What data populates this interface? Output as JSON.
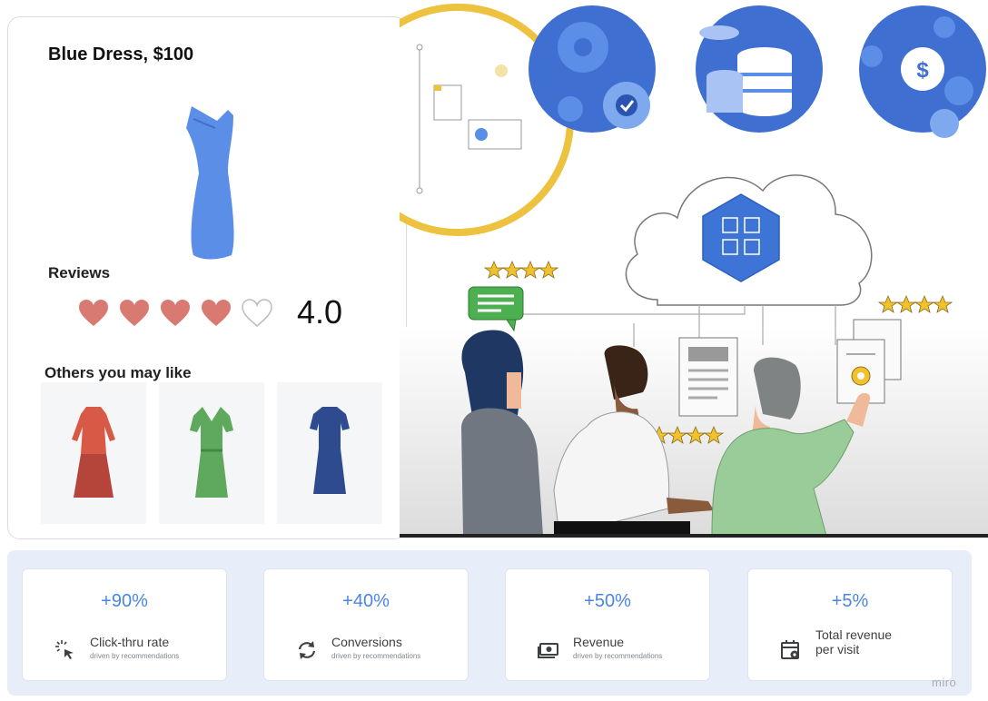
{
  "product": {
    "title": "Blue Dress, $100",
    "reviews_label": "Reviews",
    "rating": "4.0",
    "hearts_filled": 4,
    "hearts_total": 5,
    "others_label": "Others you may like"
  },
  "metrics": [
    {
      "value": "+90%",
      "label": "Click-thru rate",
      "sub": "driven by recommendations",
      "icon": "cursor-click-icon"
    },
    {
      "value": "+40%",
      "label": "Conversions",
      "sub": "driven by recommendations",
      "icon": "refresh-icon"
    },
    {
      "value": "+50%",
      "label": "Revenue",
      "sub": "driven by recommendations",
      "icon": "money-icon"
    },
    {
      "value": "+5%",
      "label": "Total revenue",
      "label2": "per visit",
      "icon": "calendar-gear-icon"
    }
  ],
  "brand": {
    "watermark": "miro"
  },
  "colors": {
    "accent_blue": "#4a86e0",
    "heart": "#d97a72",
    "dress_blue": "#5b8ee6",
    "highlight_ring": "#ecc23f"
  }
}
